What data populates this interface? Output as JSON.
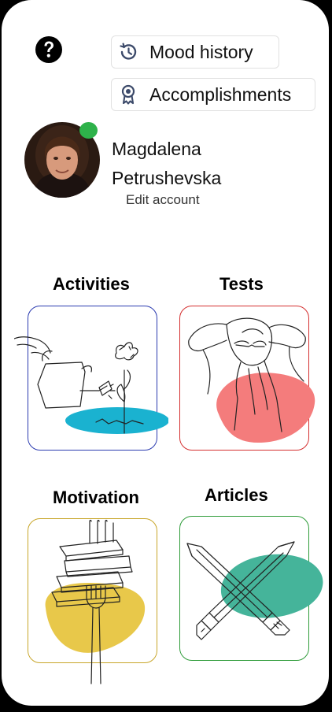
{
  "header": {
    "help_icon": "question-circle-icon",
    "mood_history_label": "Mood history",
    "mood_history_icon": "history-icon",
    "accomplishments_label": "Accomplishments",
    "accomplishments_icon": "award-ribbon-icon"
  },
  "profile": {
    "first_name": "Magdalena",
    "last_name": "Petrushevska",
    "edit_label": "Edit account",
    "status_color": "#2eb24a"
  },
  "sections": [
    {
      "title": "Activities",
      "border_color": "#2b3bb0",
      "blob_color": "#1ab2d0",
      "illustration": "watering-can-flower"
    },
    {
      "title": "Tests",
      "border_color": "#d42f2f",
      "blob_color": "#f47c7c",
      "illustration": "person-thinking"
    },
    {
      "title": "Motivation",
      "border_color": "#c8a62a",
      "blob_color": "#e8c84a",
      "illustration": "books-fork"
    },
    {
      "title": "Articles",
      "border_color": "#2f9c3a",
      "blob_color": "#45b49a",
      "illustration": "crossed-pencils"
    }
  ]
}
